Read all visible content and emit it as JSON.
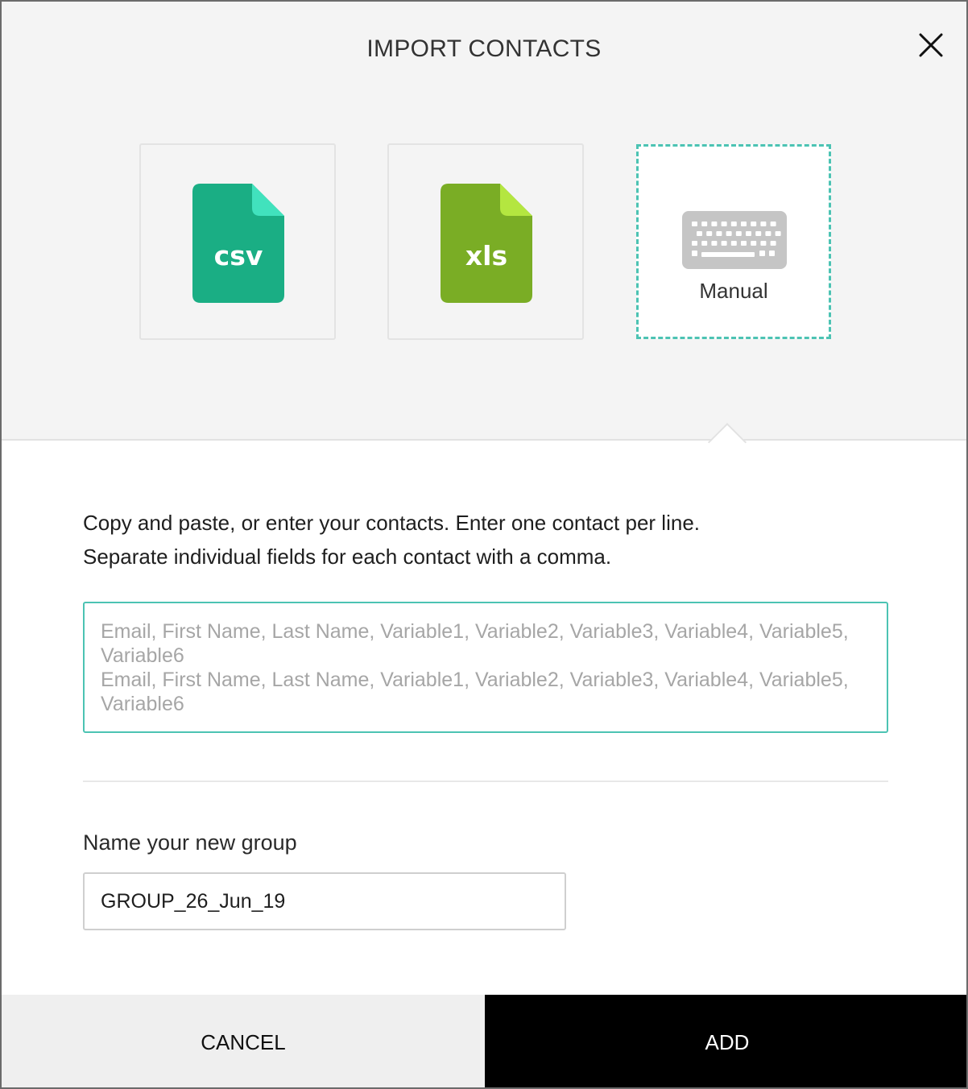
{
  "dialog": {
    "title": "IMPORT CONTACTS",
    "close_icon": "close-icon"
  },
  "import_options": [
    {
      "id": "csv",
      "label": "csv",
      "icon": "csv-file-icon",
      "color": "#1aae84",
      "fold_color": "#41e2bd",
      "selected": false
    },
    {
      "id": "xls",
      "label": "xls",
      "icon": "xls-file-icon",
      "color": "#7aad25",
      "fold_color": "#b4e640",
      "selected": false
    },
    {
      "id": "manual",
      "label": "Manual",
      "icon": "keyboard-icon",
      "color": "#c5c5c5",
      "selected": true
    }
  ],
  "manual_entry": {
    "instructions_line1": "Copy and paste, or enter your contacts. Enter one contact per line.",
    "instructions_line2": "Separate individual fields for each contact with a comma.",
    "placeholder": "Email, First Name, Last Name, Variable1, Variable2, Variable3, Variable4, Variable5, Variable6\nEmail, First Name, Last Name, Variable1, Variable2, Variable3, Variable4, Variable5, Variable6",
    "value": ""
  },
  "group": {
    "label": "Name your new group",
    "value": "GROUP_26_Jun_19"
  },
  "footer": {
    "cancel_label": "CANCEL",
    "add_label": "ADD"
  },
  "colors": {
    "accent": "#4cc3b3",
    "top_background": "#f4f4f4",
    "cancel_background": "#efefef",
    "add_background": "#000000"
  }
}
